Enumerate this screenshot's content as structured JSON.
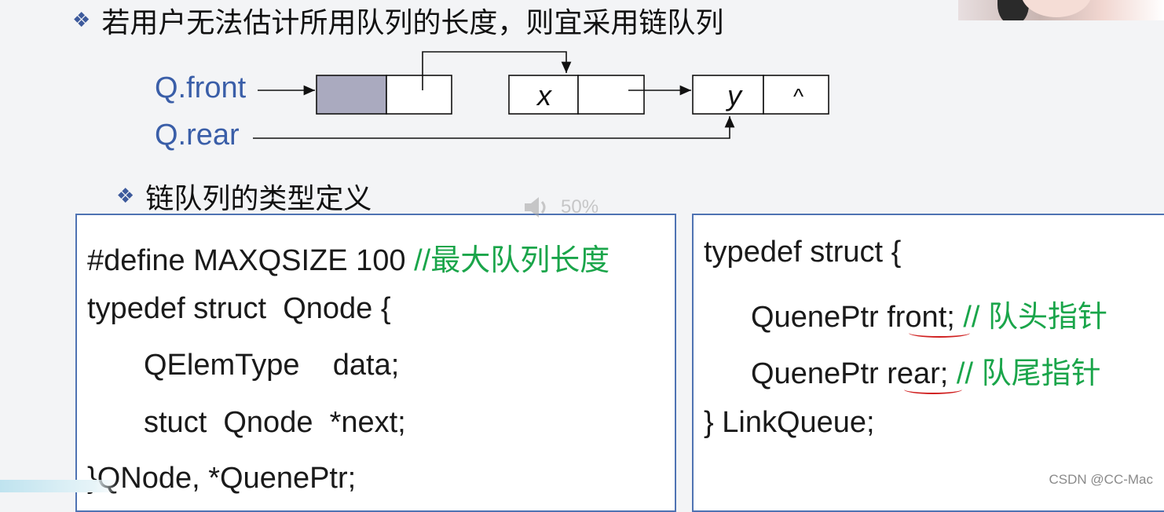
{
  "heading_primary": {
    "bullet": "❖",
    "text": "若用户无法估计所用队列的长度，则宜采用链队列"
  },
  "diagram": {
    "front_label": "Q.front",
    "rear_label": "Q.rear",
    "node_x_value": "x",
    "node_y_value": "y",
    "null_symbol": "^"
  },
  "heading_secondary": {
    "bullet": "❖",
    "text": "链队列的类型定义"
  },
  "volume_overlay": {
    "icon": "speaker-icon",
    "level_text": "50%"
  },
  "code_left": {
    "line1_code": "#define MAXQSIZE 100 ",
    "line1_comment": "//最大队列长度",
    "line2": "typedef struct  Qnode {",
    "line3": "QElemType    data;",
    "line4": "stuct  Qnode  *next;",
    "line5": "}QNode, *QuenePtr;"
  },
  "code_right": {
    "line1": "typedef struct {",
    "line2_code": "QuenePtr front; ",
    "line2_comment": "// 队头指针",
    "line3_code": "QuenePtr rear; ",
    "line3_comment": "// 队尾指针",
    "line4": "} LinkQueue;"
  },
  "watermark": "CSDN @CC-Mac",
  "colors": {
    "accent_blue": "#3a5ea8",
    "comment_green": "#1aa54a",
    "head_node_fill": "#aaaabf",
    "annotation_red": "#d02020"
  }
}
